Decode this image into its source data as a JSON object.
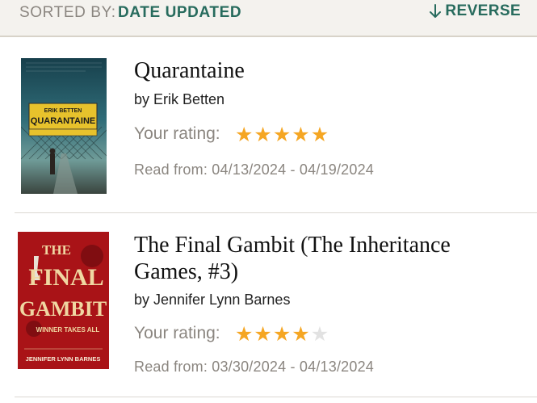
{
  "sort": {
    "label": "SORTED BY:",
    "value": "DATE UPDATED",
    "reverse_label": "REVERSE"
  },
  "books": [
    {
      "title": "Quarantaine",
      "author": "by Erik Betten",
      "rating_label": "Your rating:",
      "rating": 5,
      "rating_max": 5,
      "dates": "Read from: 04/13/2024 - 04/19/2024",
      "cover": {
        "author": "ERIK BETTEN",
        "title": "QUARANTAINE",
        "colors": {
          "top": "#1e5566",
          "mid": "#5d8f93",
          "sign": "#e7c22c",
          "ground": "#3c4540"
        }
      }
    },
    {
      "title": "The Final Gambit (The Inheritance Games, #3)",
      "author": "by Jennifer Lynn Barnes",
      "rating_label": "Your rating:",
      "rating": 4,
      "rating_max": 5,
      "dates": "Read from: 03/30/2024 - 04/13/2024",
      "cover": {
        "line1": "THE",
        "line2": "FINAL",
        "line3": "GAMBIT",
        "tagline": "WINNER TAKES ALL",
        "author": "JENNIFER LYNN BARNES",
        "colors": {
          "bg": "#b8161a",
          "text": "#f0d7a2",
          "dark": "#5e0a0c"
        }
      }
    }
  ],
  "colors": {
    "accent": "#276b5d",
    "star": "#f5a623",
    "star_empty": "#e2e2e2",
    "muted": "#8b8680"
  }
}
